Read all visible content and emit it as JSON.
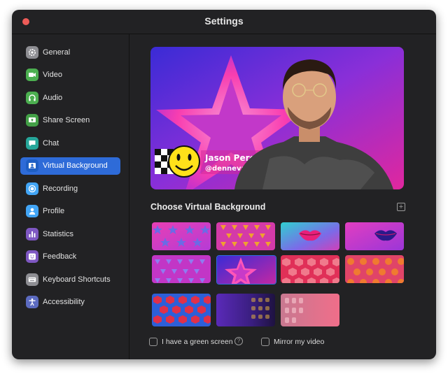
{
  "window": {
    "title": "Settings"
  },
  "sidebar": {
    "items": [
      {
        "label": "General",
        "icon": "gear-icon",
        "color": "#8e8e93"
      },
      {
        "label": "Video",
        "icon": "video-camera-icon",
        "color": "#4caf50"
      },
      {
        "label": "Audio",
        "icon": "headphones-icon",
        "color": "#4caf50"
      },
      {
        "label": "Share Screen",
        "icon": "share-screen-icon",
        "color": "#43a047"
      },
      {
        "label": "Chat",
        "icon": "chat-bubble-icon",
        "color": "#26a69a"
      },
      {
        "label": "Virtual Background",
        "icon": "person-portrait-icon",
        "color": "#1e5fc4",
        "active": true
      },
      {
        "label": "Recording",
        "icon": "record-icon",
        "color": "#42a5f5"
      },
      {
        "label": "Profile",
        "icon": "person-icon",
        "color": "#42a5f5"
      },
      {
        "label": "Statistics",
        "icon": "bar-chart-icon",
        "color": "#7e57c2"
      },
      {
        "label": "Feedback",
        "icon": "smiley-icon",
        "color": "#7e57c2"
      },
      {
        "label": "Keyboard Shortcuts",
        "icon": "keyboard-icon",
        "color": "#8e8e93"
      },
      {
        "label": "Accessibility",
        "icon": "accessibility-icon",
        "color": "#5c6bc0"
      }
    ]
  },
  "preview": {
    "name_tag": "Jason Perez",
    "handle": "@denneval"
  },
  "main": {
    "section_title": "Choose Virtual Background",
    "add_button_label": "+",
    "options": {
      "green_screen_label": "I have a green screen",
      "help_label": "?",
      "mirror_label": "Mirror my video"
    }
  },
  "backgrounds": [
    {
      "name": "pink-stars"
    },
    {
      "name": "pink-triangles"
    },
    {
      "name": "teal-lips"
    },
    {
      "name": "magenta-lips"
    },
    {
      "name": "purple-triangles"
    },
    {
      "name": "star-glow"
    },
    {
      "name": "red-hexagons"
    },
    {
      "name": "orange-dots"
    },
    {
      "name": "blue-red-hexagons"
    },
    {
      "name": "purple-blur"
    },
    {
      "name": "bokeh-pink"
    }
  ],
  "colors": {
    "window_bg": "#222224",
    "accent": "#2e6bd8",
    "close_button": "#ee5c58"
  }
}
